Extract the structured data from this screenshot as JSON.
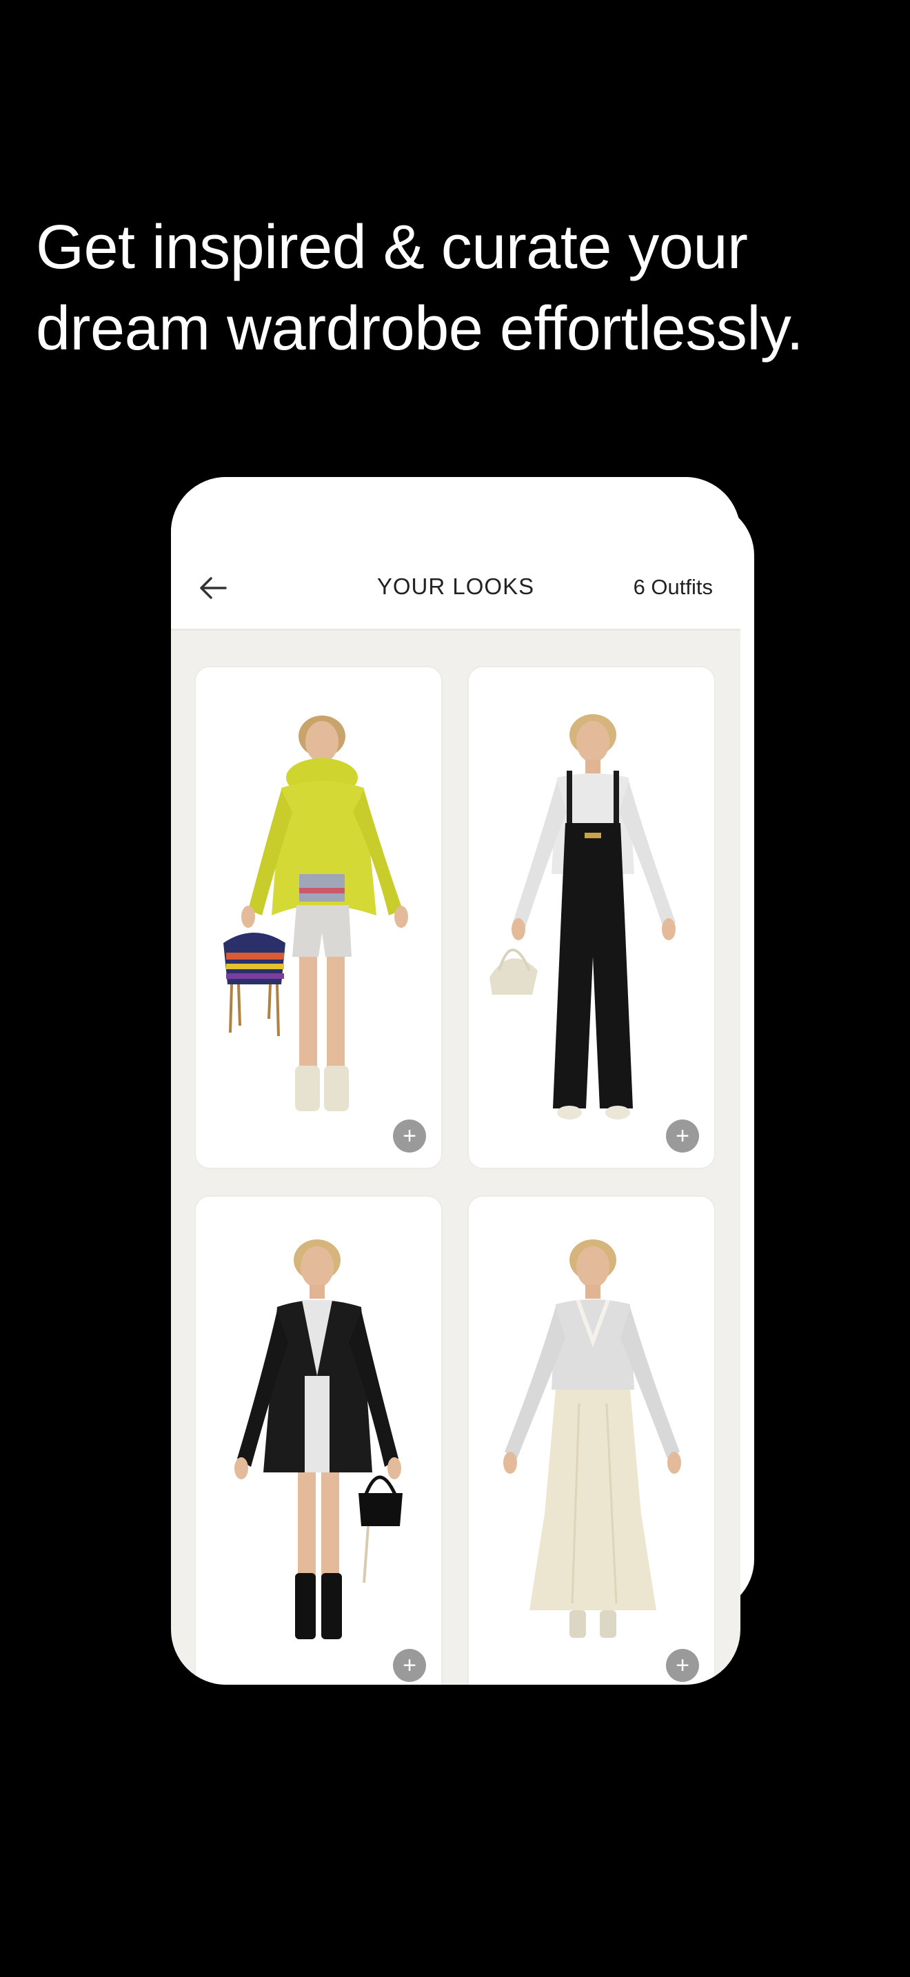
{
  "headline": {
    "line1": "Get inspired & curate your",
    "line2": "dream wardrobe effortlessly."
  },
  "app": {
    "title": "YOUR LOOKS",
    "count_label": "6 Outfits",
    "back_icon": "arrow-left-icon"
  },
  "outfits": [
    {
      "name": "yellow-jacket-outfit",
      "add_icon": "plus-icon",
      "add_label": "+"
    },
    {
      "name": "black-overalls-outfit",
      "add_icon": "plus-icon",
      "add_label": "+"
    },
    {
      "name": "black-blazer-outfit",
      "add_icon": "plus-icon",
      "add_label": "+"
    },
    {
      "name": "cream-skirt-outfit",
      "add_icon": "plus-icon",
      "add_label": "+"
    }
  ],
  "colors": {
    "background": "#000000",
    "phone_surface": "#f1f0ec",
    "card": "#ffffff",
    "add_button": "#9a9a9a"
  }
}
